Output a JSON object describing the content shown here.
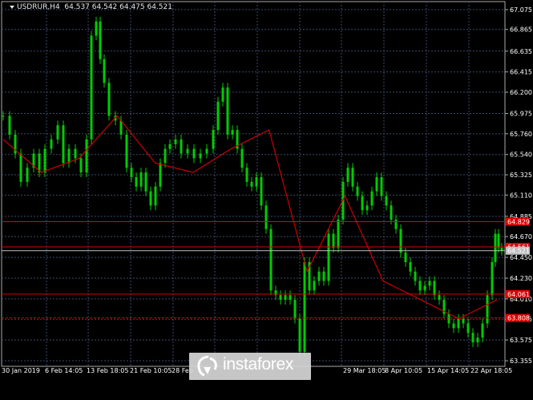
{
  "chart": {
    "symbol": "USDRUR,H4",
    "ohlc": "64.537 64.542 64.475 64.521",
    "price_axis": [
      "67.075",
      "66.865",
      "66.635",
      "66.415",
      "66.200",
      "65.975",
      "65.760",
      "65.540",
      "65.325",
      "65.110",
      "64.885",
      "64.670",
      "64.450",
      "64.230",
      "64.010",
      "63.795",
      "63.575",
      "63.355"
    ],
    "time_axis": [
      "30 Jan 2019",
      "6 Feb 14:05",
      "13 Feb 18:05",
      "21 Feb 10:05",
      "28 Feb",
      "29 Mar 18:05",
      "8 Apr 10:05",
      "15 Apr 14:05",
      "22 Apr 18:05"
    ],
    "levels": [
      {
        "value": 64.829,
        "label": "64.829",
        "color": "#dd0000",
        "style": "solid"
      },
      {
        "value": 64.561,
        "label": "64.561",
        "color": "#dd0000",
        "style": "solid"
      },
      {
        "value": 64.521,
        "label": "64.521",
        "color": "#c0c0c0",
        "style": "solid"
      },
      {
        "value": 64.061,
        "label": "64.061",
        "color": "#dd0000",
        "style": "solid"
      },
      {
        "value": 63.808,
        "label": "63.808",
        "color": "#dd0000",
        "style": "dashed"
      }
    ],
    "colors": {
      "background": "#000000",
      "grid": "#3a4a6a",
      "candles": "#00cc00",
      "moving_average": "#cc0000",
      "axis_text": "#ffffff"
    }
  },
  "watermark": {
    "text": "instaforex"
  },
  "chart_data": {
    "type": "line",
    "title": "USDRUR,H4",
    "xlabel": "",
    "ylabel": "",
    "ylim": [
      63.355,
      67.075
    ],
    "categories": [
      "30 Jan 2019",
      "6 Feb 14:05",
      "13 Feb 18:05",
      "21 Feb 10:05",
      "28 Feb",
      "29 Mar 18:05",
      "8 Apr 10:05",
      "15 Apr 14:05",
      "22 Apr 18:05"
    ],
    "series": [
      {
        "values": [
          65.7,
          65.35,
          65.5,
          65.95,
          65.45,
          65.35,
          65.6,
          65.8,
          64.3,
          65.1,
          64.2,
          64.0,
          63.8,
          64.0
        ]
      }
    ],
    "levels": [
      64.829,
      64.561,
      64.521,
      64.061,
      63.808
    ],
    "last_close": 64.521,
    "grid": true
  }
}
